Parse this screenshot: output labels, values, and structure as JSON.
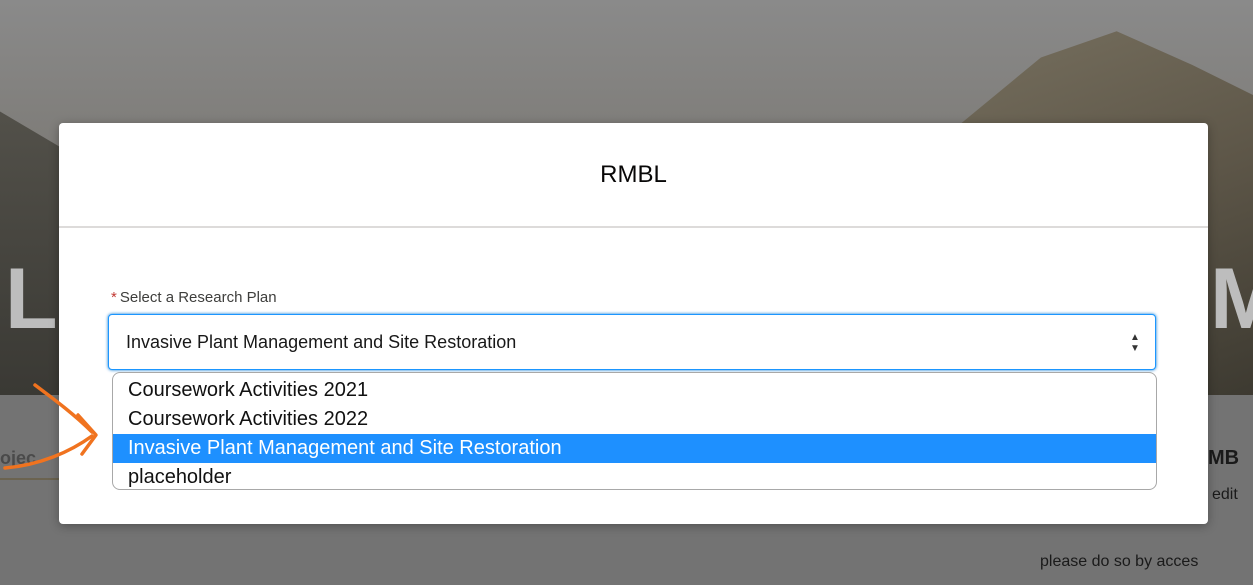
{
  "background": {
    "hero_left_text": "LC",
    "hero_right_text": "M",
    "tab_fragment": "ojec",
    "heading_fragment": "MB",
    "line1_fragment": "edit",
    "line2_fragment": "please do so by acces"
  },
  "modal": {
    "title": "RMBL",
    "field": {
      "required_marker": "*",
      "label": "Select a Research Plan",
      "selected_value": "Invasive Plant Management and Site Restoration",
      "options": [
        "Coursework Activities 2021",
        "Coursework Activities 2022",
        "Invasive Plant Management and Site Restoration",
        "placeholder"
      ],
      "selected_index": 2
    }
  },
  "icons": {
    "stepper": "up-down-stepper-icon",
    "annotation": "orange-arrow-icon"
  },
  "colors": {
    "selection": "#1e90ff",
    "focus_border": "#1b96ff",
    "required": "#c23934",
    "annotation_arrow": "#f0731f"
  }
}
